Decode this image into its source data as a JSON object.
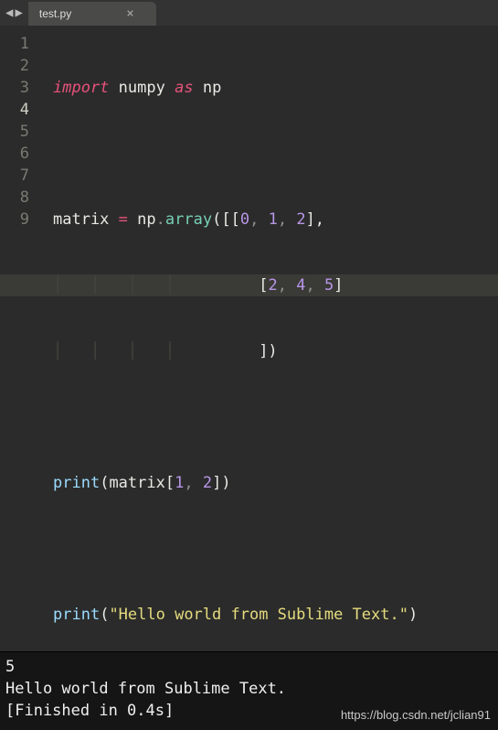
{
  "tab": {
    "name": "test.py",
    "close_glyph": "×"
  },
  "nav": {
    "back": "◀",
    "forward": "▶"
  },
  "gutter": {
    "lines": [
      "1",
      "2",
      "3",
      "4",
      "5",
      "6",
      "7",
      "8",
      "9"
    ],
    "current": 4
  },
  "code": {
    "l1": {
      "import": "import",
      "numpy": "numpy",
      "as": "as",
      "np": "np"
    },
    "l3": {
      "matrix": "matrix",
      "eq": "=",
      "np": "np",
      "dot": ".",
      "array": "array",
      "open": "([[",
      "n0": "0",
      "c1": ",",
      "n1": "1",
      "c2": ",",
      "n2": "2",
      "close": "],"
    },
    "l4": {
      "guide": "│   │   │   │",
      "pad": "         ",
      "open": "[",
      "n0": "2",
      "c1": ",",
      "n1": "4",
      "c2": ",",
      "n2": "5",
      "close": "]"
    },
    "l5": {
      "guide": "│   │   │   │",
      "pad": "         ",
      "close": "])"
    },
    "l7": {
      "print": "print",
      "op": "(",
      "matrix": "matrix",
      "lb": "[",
      "i0": "1",
      "c": ",",
      "i1": "2",
      "rb": "]",
      "cp": ")"
    },
    "l9": {
      "print": "print",
      "op": "(",
      "str": "\"Hello world from Sublime Text.\"",
      "cp": ")"
    }
  },
  "console": {
    "l1": "5",
    "l2": "Hello world from Sublime Text.",
    "l3": "[Finished in 0.4s]"
  },
  "watermark": "https://blog.csdn.net/jclian91"
}
